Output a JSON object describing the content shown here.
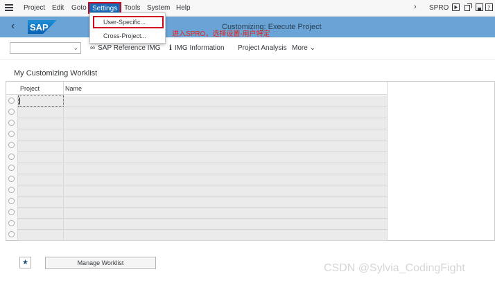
{
  "menubar": {
    "items": [
      "Project",
      "Edit",
      "Goto",
      "Settings",
      "Tools",
      "System",
      "Help"
    ],
    "transaction_code": "SPRO"
  },
  "titlebar": {
    "logo_text": "SAP",
    "title": "Customizing: Execute Project"
  },
  "toolbar": {
    "select_value": "",
    "buttons": [
      "SAP Reference IMG",
      "IMG Information",
      "Project Analysis",
      "More"
    ]
  },
  "dropdown": {
    "items": [
      "User-Specific...",
      "Cross-Project..."
    ]
  },
  "annotation": "进入SPRO，选择设置-用户特定",
  "worklist": {
    "title": "My Customizing Worklist",
    "columns": [
      "Project",
      "Name"
    ],
    "row_count": 13
  },
  "footer": {
    "manage_label": "Manage Worklist",
    "watermark": "CSDN @Sylvia_CodingFight"
  },
  "colors": {
    "titlebar": "#6aa4d6",
    "accent": "#1a6ab5",
    "highlight_border": "#d0021b",
    "annotation": "#e8231a",
    "grid": "#ebebeb"
  }
}
